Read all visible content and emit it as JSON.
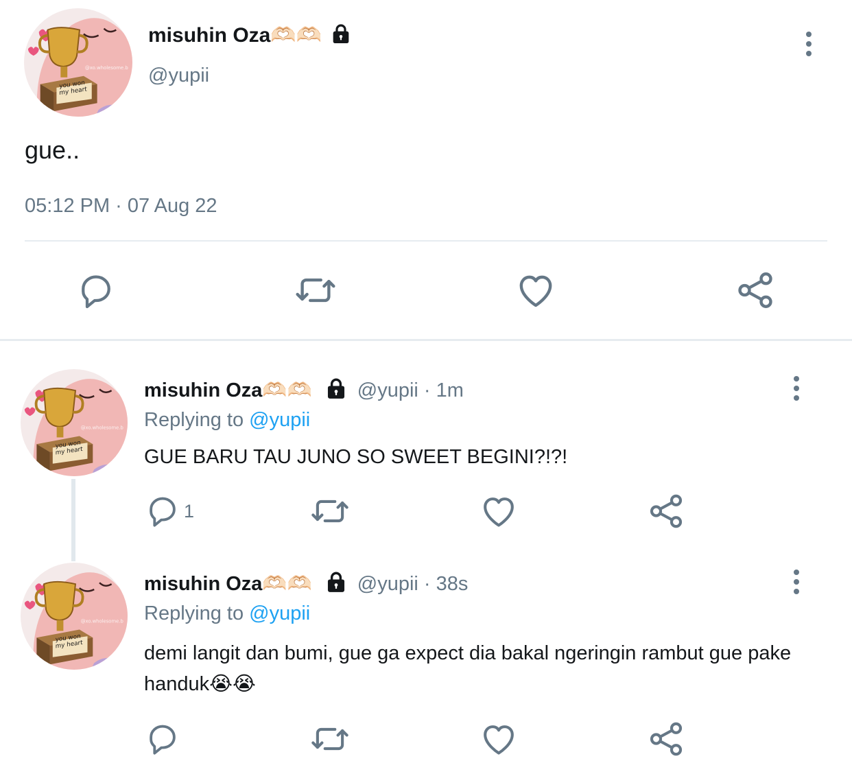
{
  "main_tweet": {
    "display_name": "misuhin Oza🫶🏻🫶🏻",
    "handle": "@yupii",
    "text": "gue..",
    "timestamp": "05:12 PM · 07 Aug 22",
    "avatar_caption": "you won my heart",
    "avatar_watermark": "@xo.wholesome.b"
  },
  "replies": [
    {
      "display_name": "misuhin Oza🫶🏻🫶🏻",
      "handle": "@yupii",
      "time": "· 1m",
      "replying_label": "Replying to",
      "replying_to": "@yupii",
      "text": "GUE BARU TAU JUNO SO SWEET BEGINI?!?!",
      "reply_count": "1"
    },
    {
      "display_name": "misuhin Oza🫶🏻🫶🏻",
      "handle": "@yupii",
      "time": "· 38s",
      "replying_label": "Replying to",
      "replying_to": "@yupii",
      "text": "demi langit dan bumi, gue ga expect dia bakal ngeringin rambut gue pake handuk😭😭",
      "reply_count": ""
    }
  ],
  "colors": {
    "text": "#14171a",
    "muted": "#657786",
    "link": "#1da1f2",
    "divider": "#e6ecf0"
  },
  "icons": [
    "reply-icon",
    "retweet-icon",
    "like-icon",
    "share-icon",
    "lock-icon",
    "more-icon"
  ]
}
